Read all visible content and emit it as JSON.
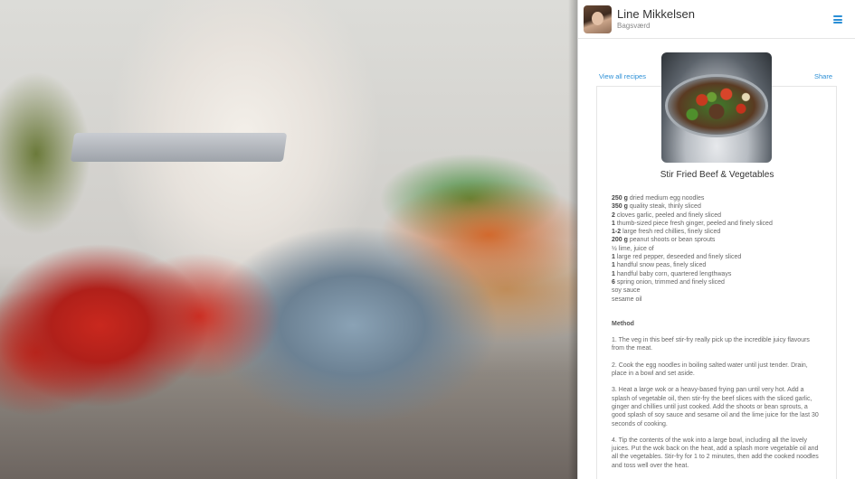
{
  "user": {
    "name": "Line Mikkelsen",
    "city": "Bagsværd"
  },
  "icons": {
    "menu": "hamburger-menu-icon",
    "avatar": "user-avatar"
  },
  "accent_color": "#2b8fd6",
  "links": {
    "view_all": "View all recipes",
    "share": "Share"
  },
  "recipe": {
    "title": "Stir Fried Beef & Vegetables",
    "ingredients": [
      {
        "qty": "250 g",
        "text": " dried medium egg noodles"
      },
      {
        "qty": "350 g",
        "text": " quality steak, thinly sliced"
      },
      {
        "qty": "2",
        "text": " cloves garlic, peeled and finely sliced"
      },
      {
        "qty": "1",
        "text": " thumb-sized piece fresh ginger, peeled and finely sliced"
      },
      {
        "qty": "1-2",
        "text": " large fresh red chillies, finely sliced"
      },
      {
        "qty": "200 g",
        "text": " peanut shoots or bean sprouts"
      },
      {
        "qty": "",
        "text": "½ lime, juice of"
      },
      {
        "qty": "1",
        "text": " large red pepper, deseeded and finely sliced"
      },
      {
        "qty": "1",
        "text": " handful snow peas, finely sliced"
      },
      {
        "qty": "1",
        "text": " handful baby corn, quartered lengthways"
      },
      {
        "qty": "6",
        "text": " spring onion, trimmed and finely sliced"
      },
      {
        "qty": "",
        "text": "soy sauce"
      },
      {
        "qty": "",
        "text": "sesame oil"
      }
    ],
    "method_title": "Method",
    "steps": [
      "1. The veg in this beef stir-fry really pick up the incredible juicy flavours from the meat.",
      "2. Cook the egg noodles in boiling salted water until just tender. Drain, place in a bowl and set aside.",
      "3. Heat a large wok or a heavy-based frying pan until very hot. Add a splash of vegetable oil, then stir-fry the beef slices with the sliced garlic, ginger and chillies until just cooked. Add the shoots or bean sprouts, a good splash of soy sauce and sesame oil and the lime juice for the last 30 seconds of cooking.",
      "4. Tip the contents of the wok into a large bowl, including all the lovely juices. Put the wok back on the heat, add a splash more vegetable oil and all the vegetables. Stir-fry for 1 to 2 minutes, then add the cooked noodles and toss well over the heat."
    ]
  }
}
